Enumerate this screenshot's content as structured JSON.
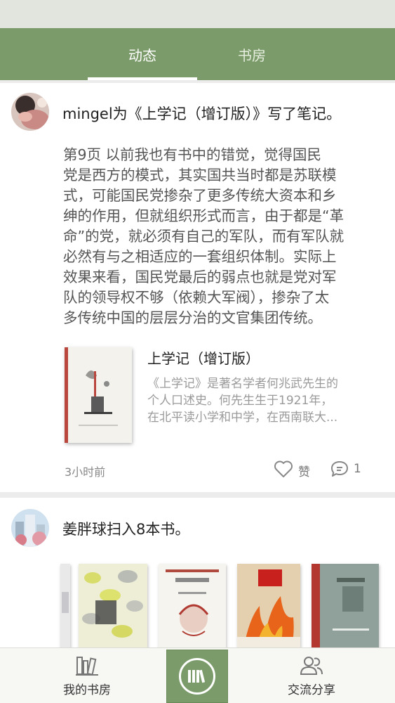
{
  "tabs": {
    "dynamic": "动态",
    "study": "书房"
  },
  "post1": {
    "headline": "mingel为《上学记（增订版）》写了笔记。",
    "note_lines": [
      "第9页  以前我也有书中的错觉，觉得国民",
      "党是西方的模式，其实国共当时都是苏联模",
      "式，可能国民党掺杂了更多传统大资本和乡",
      "绅的作用，但就组织形式而言，由于都是“革",
      "命”的党，就必须有自己的军队，而有军队就",
      "必然有与之相适应的一套组织体制。实际上",
      "效果来看，国民党最后的弱点也就是党对军",
      "队的领导权不够（依赖大军阀），掺杂了太",
      "多传统中国的层层分治的文官集团传统。"
    ],
    "book_title": "上学记（增订版）",
    "book_desc_lines": [
      "《上学记》是著名学者何兆武先生的",
      "个人口述史。何先生生于1921年，",
      "在北平读小学和中学，在西南联大..."
    ],
    "time": "3小时前",
    "like_label": "赞",
    "comment_count": "1"
  },
  "post2": {
    "headline": "姜胖球扫入8本书。"
  },
  "bottom_nav": {
    "my_study": "我的书房",
    "share": "交流分享"
  },
  "colors": {
    "theme_green": "#7c9b6a",
    "active_tab_text": "#ffffff"
  }
}
